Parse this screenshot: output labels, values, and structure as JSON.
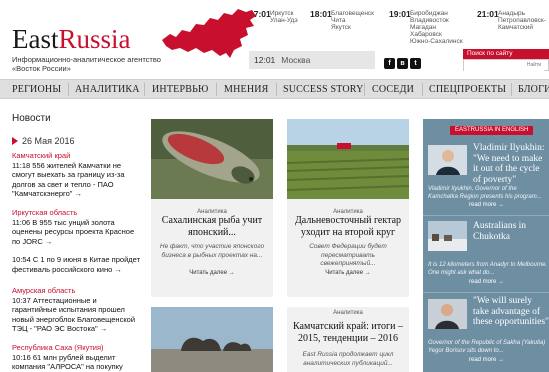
{
  "brand": {
    "name_part1": "East",
    "name_part2": "Russia",
    "tagline_line1": "Информационно-аналитическое агентство",
    "tagline_line2": "«Восток России»",
    "accent_color": "#c8102e"
  },
  "timezones": [
    {
      "time": "17:01",
      "cities": [
        "Иркутск",
        "Улан-Удэ"
      ]
    },
    {
      "time": "18:01",
      "cities": [
        "Благовещенск",
        "Чита",
        "Якутск"
      ]
    },
    {
      "time": "19:01",
      "cities": [
        "Биробиджан",
        "Владивосток",
        "Магадан",
        "Хабаровск",
        "Южно-Сахалинск"
      ]
    },
    {
      "time": "21:01",
      "cities": [
        "Анадырь",
        "Петропавловск-",
        "Камчатский"
      ]
    }
  ],
  "current_time": {
    "time": "12:01",
    "city": "Москва"
  },
  "social": {
    "icons": [
      "facebook-icon",
      "vk-icon",
      "twitter-icon"
    ],
    "glyphs": [
      "f",
      "в",
      "t"
    ]
  },
  "search": {
    "label": "Поиск по сайту",
    "placeholder": "",
    "button": "Найти"
  },
  "nav": {
    "items": [
      "РЕГИОНЫ",
      "АНАЛИТИКА",
      "ИНТЕРВЬЮ",
      "МНЕНИЯ",
      "SUCCESS STORY",
      "СОСЕДИ",
      "СПЕЦПРОЕКТЫ",
      "БЛОГИ"
    ]
  },
  "news": {
    "heading": "Новости",
    "date": "26 Мая 2016",
    "items": [
      {
        "region": "Камчатский край",
        "text": "11:18 556 жителей Камчатки не смогут выехать за границу из-за долгов за свет и тепло - ПАО \"Камчатскэнерго\" →"
      },
      {
        "region": "Иркутская область",
        "text": "11:06 В 955 тыс унций золота оценены ресурсы проекта Красное по JORC →"
      },
      {
        "region": "",
        "text": "10:54 С 1 по 9 июня в Китае пройдет фестиваль российского кино →"
      },
      {
        "region": "Амурская область",
        "text": "10:37 Аттестационные и гарантийные испытания прошел новый энергоблок Благовещенской ТЭЦ - \"РАО ЭС Востока\" →"
      },
      {
        "region": "Республика Саха (Якутия)",
        "text": "10:16 61 млн рублей выделит компания \"АЛРОСА\" на покупку"
      }
    ]
  },
  "articles": [
    {
      "category": "Аналитика",
      "title": "Сахалинская рыба учит японский...",
      "lead": "Не факт, что участие японского бизнеса в рыбных проектах на...",
      "more": "Читать далее →"
    },
    {
      "category": "Аналитика",
      "title": "Дальневосточный гектар уходит на второй круг",
      "lead": "Совет Федерации будет пересматривать свежепринятый...",
      "more": "Читать далее →"
    },
    {
      "category": "",
      "title": "",
      "lead": "",
      "more": ""
    },
    {
      "category": "Аналитика",
      "title": "Камчатский край: итоги – 2015, тенденции – 2016",
      "lead": "East Russia продолжает цикл аналитических публикаций...",
      "more": ""
    }
  ],
  "sidebar": {
    "label": "EASTRUSSIA IN ENGLISH",
    "items": [
      {
        "title": "Vladimir Ilyukhin: \"We need to make it out of the cycle of poverty\"",
        "desc": "Vladimir Ilyukhin, Governor of the Kamchatka Region presents his program...",
        "more": "read more →"
      },
      {
        "title": "Australians in Chukotka",
        "desc": "It is 12 kilometers from Anadyr to Melbourne. One might ask what do...",
        "more": "read more →"
      },
      {
        "title": "\"We will surely take advantage of these opportunities\"",
        "desc": "Governor of the Republic of Sakha (Yakutia) Yegor Borisov sits down to...",
        "more": "read more →"
      }
    ]
  }
}
